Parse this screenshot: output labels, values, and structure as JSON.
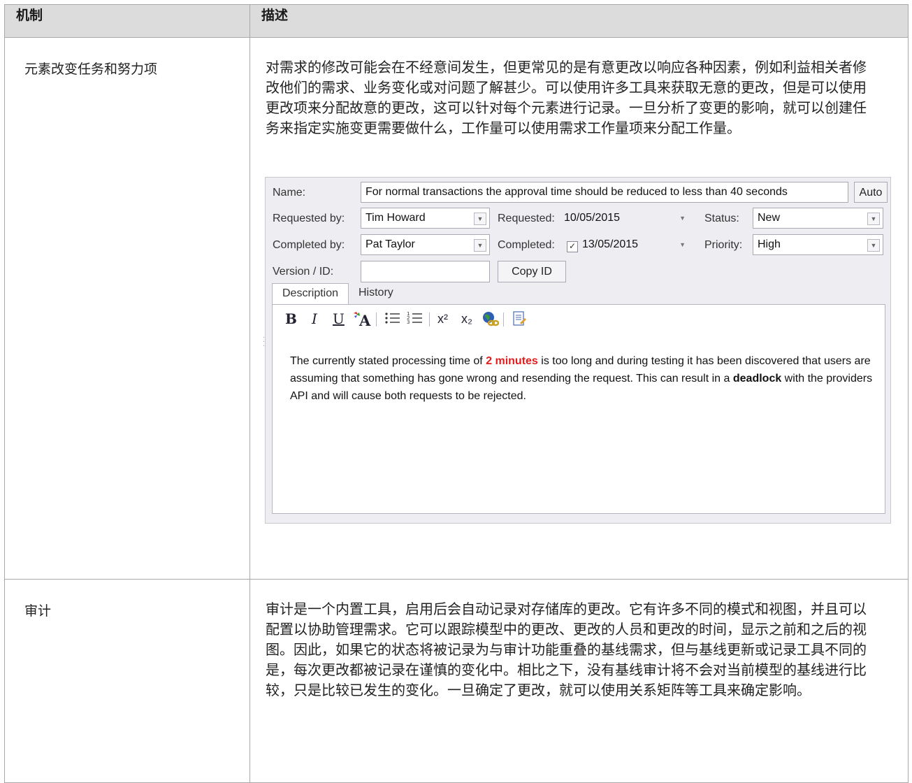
{
  "table": {
    "headers": [
      "机制",
      "描述"
    ],
    "rows": [
      {
        "mechanism": "元素改变任务和努力项",
        "description": "对需求的修改可能会在不经意间发生，但更常见的是有意更改以响应各种因素，例如利益相关者修改他们的需求、业务变化或对问题了解甚少。可以使用许多工具来获取无意的更改，但是可以使用更改项来分配故意的更改，这可以针对每个元素进行记录。一旦分析了变更的影响，就可以创建任务来指定实施变更需要做什么，工作量可以使用需求工作量项来分配工作量。"
      },
      {
        "mechanism": "审计",
        "description": "审计是一个内置工具，启用后会自动记录对存储库的更改。它有许多不同的模式和视图，并且可以配置以协助管理需求。它可以跟踪模型中的更改、更改的人员和更改的时间，显示之前和之后的视图。因此，如果它的状态将被记录为与审计功能重叠的基线需求，但与基线更新或记录工具不同的是，每次更改都被记录在谨慎的变化中。相比之下，没有基线审计将不会对当前模型的基线进行比较，只是比较已发生的变化。一旦确定了更改，就可以使用关系矩阵等工具来确定影响。"
      }
    ]
  },
  "dialog": {
    "name_label": "Name:",
    "name_value": "For normal transactions the approval time should be reduced to less than 40 seconds",
    "auto_button": "Auto",
    "requested_by_label": "Requested by:",
    "requested_by_value": "Tim Howard",
    "requested_label": "Requested:",
    "requested_value": "10/05/2015",
    "status_label": "Status:",
    "status_value": "New",
    "completed_by_label": "Completed by:",
    "completed_by_value": "Pat Taylor",
    "completed_label": "Completed:",
    "completed_value": "13/05/2015",
    "priority_label": "Priority:",
    "priority_value": "High",
    "version_label": "Version / ID:",
    "version_value": "",
    "copy_id_button": "Copy ID",
    "tabs": [
      "Description",
      "History"
    ],
    "toolbar": {
      "bold": "B",
      "italic": "I",
      "underline": "U",
      "superscript": "x²",
      "subscript": "x₂"
    },
    "description": {
      "p1": "The currently stated processing time of ",
      "highlight": "2 minutes",
      "p2": " is too long and during testing it has been discovered that users are assuming that something has gone wrong and resending the request. This can result in a ",
      "bold": "deadlock",
      "p3": " with the providers API and will cause both requests to be rejected."
    }
  }
}
